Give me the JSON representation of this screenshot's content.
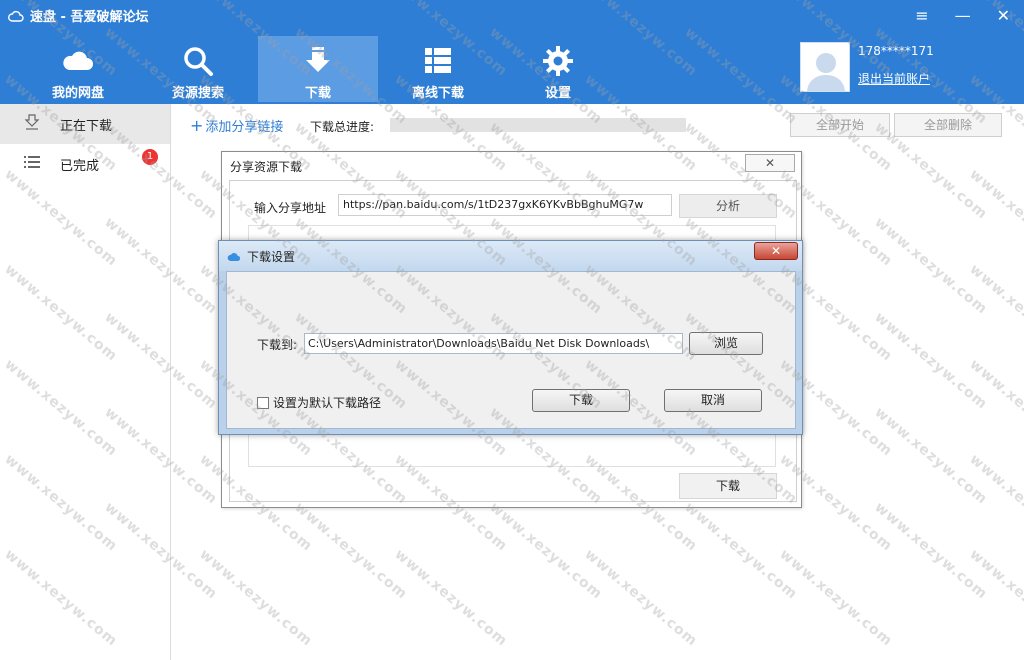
{
  "app": {
    "title": "速盘 - 吾爱破解论坛"
  },
  "window_controls": {
    "menu": "≡",
    "minimize": "—",
    "close": "✕"
  },
  "nav": {
    "items": [
      {
        "label": "我的网盘",
        "icon": "cloud-icon"
      },
      {
        "label": "资源搜索",
        "icon": "search-icon"
      },
      {
        "label": "下载",
        "icon": "download-icon",
        "active": true
      },
      {
        "label": "离线下载",
        "icon": "list-grid-icon"
      },
      {
        "label": "设置",
        "icon": "gear-icon"
      }
    ]
  },
  "user": {
    "name": "178*****171",
    "logout": "退出当前账户"
  },
  "sidebar": {
    "items": [
      {
        "label": "正在下载",
        "icon": "download-tray-icon",
        "active": true
      },
      {
        "label": "已完成",
        "icon": "list-icon",
        "badge": "1"
      }
    ]
  },
  "toolbar": {
    "add_link": "添加分享链接",
    "progress_label": "下载总进度:",
    "progress": 0,
    "start_all": "全部开始",
    "delete_all": "全部删除"
  },
  "share_dialog": {
    "title": "分享资源下载",
    "close": "✕",
    "url_label": "输入分享地址",
    "url_value": "https://pan.baidu.com/s/1tD237gxK6YKvBbBghuMG7w",
    "analyze": "分析",
    "download": "下载"
  },
  "settings_dialog": {
    "title": "下载设置",
    "close": "✕",
    "path_label": "下载到:",
    "path_value": "C:\\Users\\Administrator\\Downloads\\Baidu Net Disk Downloads\\",
    "browse": "浏览",
    "default_checkbox": "设置为默认下载路径",
    "ok": "下载",
    "cancel": "取消"
  },
  "watermark": "www.xezyw.com"
}
